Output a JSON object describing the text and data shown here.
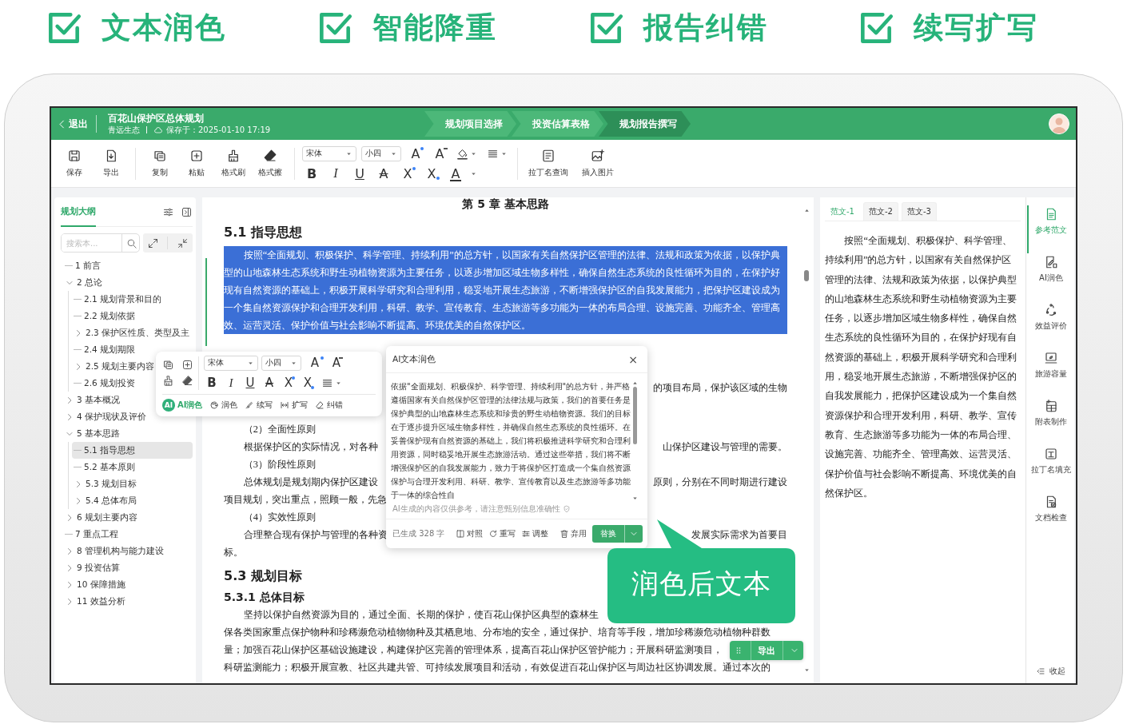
{
  "features": [
    {
      "label": "文本润色",
      "checked": true
    },
    {
      "label": "智能降重",
      "checked": true
    },
    {
      "label": "报告纠错",
      "checked": true
    },
    {
      "label": "续写扩写",
      "checked": true
    }
  ],
  "topbar": {
    "back": "退出",
    "title": "百花山保护区总体规划",
    "org": "青远生态",
    "saved": "保存于：2025-01-10 17:19",
    "steps": [
      {
        "label": "规划项目选择",
        "selected": false
      },
      {
        "label": "投资估算表格",
        "selected": false
      },
      {
        "label": "规划报告撰写",
        "selected": true
      }
    ]
  },
  "toolbar": {
    "groups": [
      [
        {
          "label": "保存",
          "kind": "save"
        },
        {
          "label": "导出",
          "kind": "export"
        }
      ],
      [
        {
          "label": "复制",
          "kind": "copy"
        },
        {
          "label": "粘贴",
          "kind": "paste"
        },
        {
          "label": "格式刷",
          "kind": "brush"
        },
        {
          "label": "格式擦",
          "kind": "eraser"
        }
      ]
    ],
    "font": "宋体",
    "size": "小四",
    "format_top": [
      {
        "glyph": "A",
        "kind": "grow"
      },
      {
        "glyph": "A",
        "kind": "shrink"
      }
    ],
    "format_bottom": [
      {
        "glyph": "B",
        "kind": "bold"
      },
      {
        "glyph": "I",
        "kind": "italic"
      },
      {
        "glyph": "U",
        "kind": "underline"
      },
      {
        "glyph": "A",
        "kind": "strike"
      },
      {
        "glyph": "X",
        "kind": "sup"
      },
      {
        "glyph": "X",
        "kind": "sub"
      },
      {
        "glyph": "A",
        "kind": "color"
      }
    ],
    "tools": [
      {
        "label": "拉丁名查询",
        "kind": "latin"
      },
      {
        "label": "插入图片",
        "kind": "image"
      }
    ]
  },
  "outline": {
    "tab": "规划大纲",
    "search": {
      "placeholder": "搜索本..."
    },
    "tree": [
      {
        "label": "1 前言",
        "selected": false
      },
      {
        "label": "2 总论",
        "selected": false,
        "expanded": true,
        "children": [
          {
            "label": "2.1 规划背景和目的",
            "selected": false
          },
          {
            "label": "2.2 规划依据",
            "selected": false
          },
          {
            "label": "2.3 保护区性质、类型及主",
            "selected": false,
            "expanded": false
          },
          {
            "label": "2.4 规划期限",
            "selected": false
          },
          {
            "label": "2.5 规划主要内容",
            "selected": false,
            "expanded": false
          },
          {
            "label": "2.6 规划投资",
            "selected": false
          }
        ]
      },
      {
        "label": "3 基本概况",
        "selected": false,
        "expanded": false
      },
      {
        "label": "4 保护现状及评价",
        "selected": false,
        "expanded": false
      },
      {
        "label": "5 基本思路",
        "selected": false,
        "expanded": true,
        "children": [
          {
            "label": "5.1 指导思想",
            "selected": true
          },
          {
            "label": "5.2 基本原则",
            "selected": false
          },
          {
            "label": "5.3 规划目标",
            "selected": false,
            "expanded": false
          },
          {
            "label": "5.4 总体布局",
            "selected": false,
            "expanded": false
          }
        ]
      },
      {
        "label": "6 规划主要内容",
        "selected": false,
        "expanded": false
      },
      {
        "label": "7 重点工程",
        "selected": false
      },
      {
        "label": "8 管理机构与能力建设",
        "selected": false,
        "expanded": false
      },
      {
        "label": "9 投资估算",
        "selected": false,
        "expanded": false
      },
      {
        "label": "10 保障措施",
        "selected": false,
        "expanded": false
      },
      {
        "label": "11 效益分析",
        "selected": false,
        "expanded": false
      }
    ]
  },
  "document": {
    "blocks": [
      {
        "kind": "chapter",
        "text": "第 5 章 基本思路"
      },
      {
        "kind": "h2",
        "text": "5.1 指导思想"
      },
      {
        "kind": "para",
        "highlighted": true,
        "text": "按照“全面规划、积极保护、科学管理、持续利用”的总方针，以国家有关自然保护区管理的法律、法规和政策为依据，以保护典型的山地森林生态系统和野生动植物资源为主要任务，以逐步增加区域生物多样性，确保自然生态系统的良性循环为目的，在保护好现有自然资源的基础上，积极开展科学研究和合理利用，稳妥地开展生态旅游，不断增强保护区的自我发展能力，把保护区建设成为一个集自然资源保护和合理开发利用，科研、教学、宣传教育、生态旅游等多功能为一体的布局合理、设施完善、功能齐全、管理高效、运营灵活、保护价值与社会影响不断提高、环境优美的自然保护区。"
      },
      {
        "kind": "tail",
        "right": "的项目布局，保护该区域的生物"
      },
      {
        "kind": "item",
        "text": "（2）全面性原则"
      },
      {
        "kind": "split",
        "left": "根据保护区的实际情况，对各种",
        "right": "山保护区建设与管理的需要。"
      },
      {
        "kind": "item",
        "text": "（3）阶段性原则"
      },
      {
        "kind": "split",
        "left": "总体规划是规划期内保护区建设",
        "right": "原则，分别在不同时期进行建设"
      },
      {
        "kind": "line",
        "text": "项目规划，突出重点，照顾一般，先急"
      },
      {
        "kind": "item",
        "text": "（4）实效性原则"
      },
      {
        "kind": "split",
        "left": "合理整合现有保护与管理的各种资",
        "right": "发展实际需求为首要目"
      },
      {
        "kind": "line",
        "text": "标。"
      },
      {
        "kind": "h2",
        "text": "5.3 规划目标"
      },
      {
        "kind": "h3",
        "text": "5.3.1 总体目标"
      },
      {
        "kind": "para",
        "text": "坚持以保护自然资源为目的，通过全面、长期的保护，使百花山保护区典型的森林生"
      },
      {
        "kind": "line",
        "text": "保各类国家重点保护物种和珍稀濒危动植物物种及其栖息地、分布地的安全，通过保护、培育等手段，增加珍稀濒危动植物种群数"
      },
      {
        "kind": "line",
        "text": "量；加强百花山保护区基础设施建设，构建保护区完善的管理体系，提高百花山保护区管护能力；开展科研监测项目，"
      },
      {
        "kind": "line",
        "text": "科研监测能力；积极开展宣教、社区共建共管、可持续发展项目和活动，有效促进百花山保护区与周边社区协调发展。通过本次的"
      }
    ]
  },
  "float_toolbar": {
    "font": "宋体",
    "size": "小四",
    "format_top": [
      {
        "glyph": "A",
        "kind": "grow"
      },
      {
        "glyph": "A",
        "kind": "shrink"
      }
    ],
    "format_bottom": [
      {
        "glyph": "B",
        "kind": "bold"
      },
      {
        "glyph": "I",
        "kind": "italic"
      },
      {
        "glyph": "U",
        "kind": "underline"
      },
      {
        "glyph": "A",
        "kind": "strike"
      },
      {
        "glyph": "X",
        "kind": "sup"
      },
      {
        "glyph": "X",
        "kind": "sub"
      }
    ],
    "actions": [
      {
        "label": "AI润色",
        "kind": "ai",
        "badge": "AI"
      },
      {
        "label": "润色",
        "kind": "polish"
      },
      {
        "label": "续写",
        "kind": "continue"
      },
      {
        "label": "扩写",
        "kind": "expand"
      },
      {
        "label": "纠错",
        "kind": "correct"
      }
    ]
  },
  "ai_panel": {
    "title": "AI文本润色",
    "close": "×",
    "text": "依据\"全面规划、积极保护、科学管理、持续利用\"的总方针，并严格遵循国家有关自然保护区管理的法律法规与政策，我们的首要任务是保护典型的山地森林生态系统和珍贵的野生动植物资源。我们的目标在于逐步提升区域生物多样性，并确保自然生态系统的良性循环。在妥善保护现有自然资源的基础上，我们将积极推进科学研究和合理利用资源，同时稳妥地开展生态旅游活动。通过这些举措，我们将不断增强保护区的自我发展能力，致力于将保护区打造成一个集自然资源保护与合理开发利用、科研、教学、宣传教育以及生态旅游等多功能于一体的综合性自",
    "note": "AI生成的内容仅供参考，请注意甄别信息准确性",
    "count": "已生成 328 字",
    "actions": [
      {
        "label": "对照",
        "kind": "compare"
      },
      {
        "label": "重写",
        "kind": "rewrite"
      },
      {
        "label": "调整",
        "kind": "adjust"
      },
      {
        "label": "弃用",
        "kind": "discard"
      }
    ],
    "primary": "替换"
  },
  "callout": {
    "text": "润色后文本"
  },
  "export_button": {
    "label": "导出"
  },
  "samples": {
    "tabs": [
      {
        "label": "范文-1",
        "selected": true
      },
      {
        "label": "范文-2",
        "selected": false
      },
      {
        "label": "范文-3",
        "selected": false
      }
    ],
    "text": "按照“全面规划、积极保护、科学管理、持续利用”的总方针，以国家有关自然保护区管理的法律、法规和政策为依据，以保护典型的山地森林生态系统和野生动植物资源为主要任务，以逐步增加区域生物多样性，确保自然生态系统的良性循环为目的，在保护好现有自然资源的基础上，积极开展科学研究和合理利用，稳妥地开展生态旅游，不断增强保护区的自我发展能力，把保护区建设成为一个集自然资源保护和合理开发利用，科研、教学、宣传教育、生态旅游等多功能为一体的布局合理、设施完善、功能齐全、管理高效、运营灵活、保护价值与社会影响不断提高、环境优美的自然保护区。"
  },
  "rail": {
    "items": [
      {
        "label": "参考范文",
        "kind": "sample",
        "selected": true
      },
      {
        "label": "AI润色",
        "kind": "polish",
        "selected": false
      },
      {
        "label": "效益评价",
        "kind": "benefit",
        "selected": false
      },
      {
        "label": "旅游容量",
        "kind": "capacity",
        "selected": false
      },
      {
        "label": "附表制作",
        "kind": "table",
        "selected": false
      },
      {
        "label": "拉丁名填充",
        "kind": "latin",
        "selected": false
      },
      {
        "label": "文档检查",
        "kind": "check",
        "selected": false
      }
    ],
    "collapse": "收起"
  }
}
